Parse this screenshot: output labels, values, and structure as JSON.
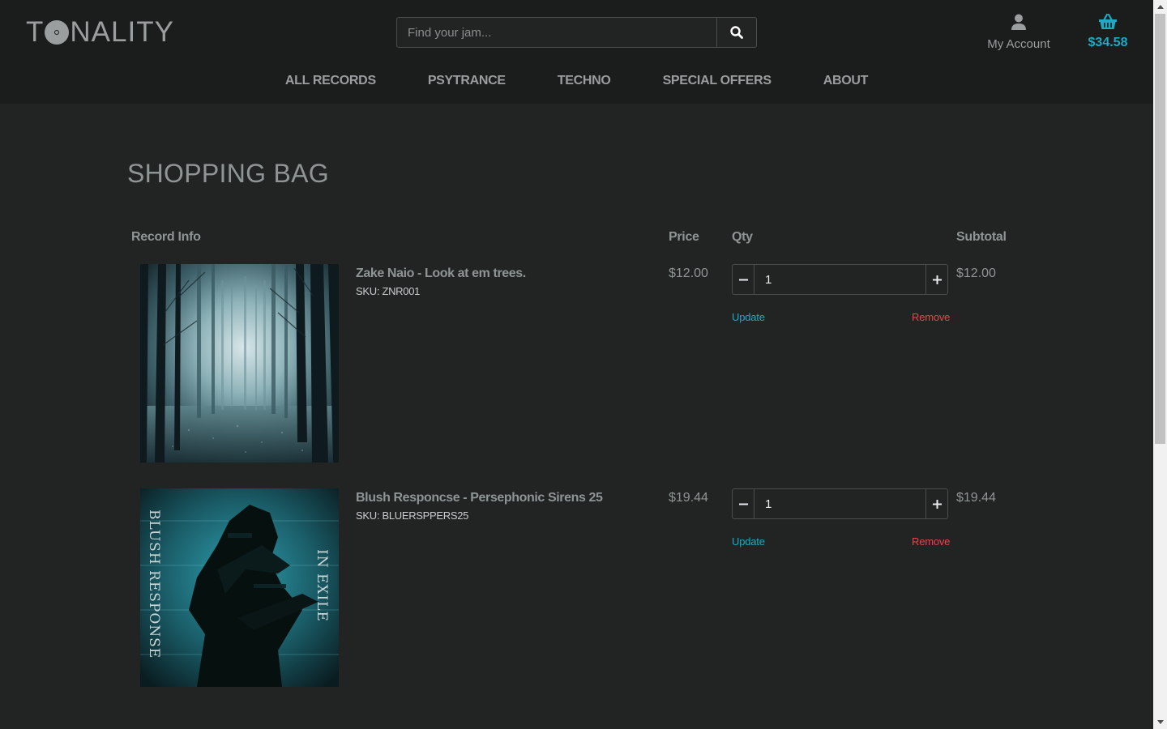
{
  "brand": {
    "logo_text_prefix": "T",
    "logo_text_suffix": "NALITY",
    "logo_full": "TONALITY"
  },
  "search": {
    "placeholder": "Find your jam..."
  },
  "account": {
    "label": "My Account"
  },
  "cart": {
    "total": "$34.58"
  },
  "nav": [
    "ALL RECORDS",
    "PSYTRANCE",
    "TECHNO",
    "SPECIAL OFFERS",
    "ABOUT"
  ],
  "page": {
    "title": "SHOPPING BAG"
  },
  "table": {
    "headers": {
      "record_info": "Record Info",
      "price": "Price",
      "qty": "Qty",
      "subtotal": "Subtotal"
    }
  },
  "items": [
    {
      "name": "Zake Naio - Look at em trees.",
      "sku": "SKU: ZNR001",
      "price": "$12.00",
      "qty": "1",
      "subtotal": "$12.00",
      "update_label": "Update",
      "remove_label": "Remove"
    },
    {
      "name": "Blush Responcse - Persephonic Sirens 25",
      "sku": "SKU: BLUERSPPERS25",
      "price": "$19.44",
      "qty": "1",
      "subtotal": "$19.44",
      "update_label": "Update",
      "remove_label": "Remove",
      "cover_text_left": "BLUSH RESPONSE",
      "cover_text_right": "IN EXILE"
    }
  ],
  "colors": {
    "accent": "#1ea9c4",
    "danger": "#e8434a",
    "background": "#222424",
    "header": "#1b1c1c"
  }
}
